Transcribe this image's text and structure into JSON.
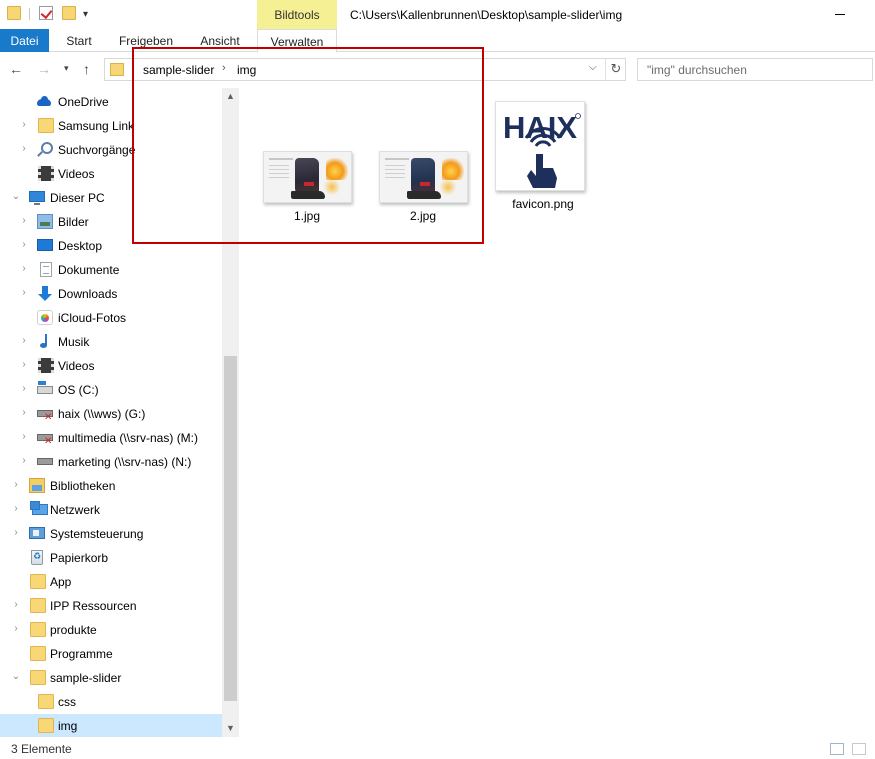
{
  "window": {
    "path_title": "C:\\Users\\Kallenbrunnen\\Desktop\\sample-slider\\img",
    "context_tab_group": "Bildtools"
  },
  "ribbon": {
    "tabs": [
      {
        "label": "Datei"
      },
      {
        "label": "Start"
      },
      {
        "label": "Freigeben"
      },
      {
        "label": "Ansicht"
      },
      {
        "label": "Verwalten"
      }
    ]
  },
  "address": {
    "crumbs": [
      "sample-slider",
      "img"
    ],
    "search_placeholder": "\"img\" durchsuchen"
  },
  "nav": {
    "items": [
      {
        "label": "OneDrive",
        "icon": "onedrive-icon",
        "expandable": false
      },
      {
        "label": "Samsung Link",
        "icon": "folder-icon",
        "expandable": true
      },
      {
        "label": "Suchvorgänge",
        "icon": "search-icon",
        "expandable": true
      },
      {
        "label": "Videos",
        "icon": "video-icon",
        "expandable": false
      },
      {
        "label": "Dieser PC",
        "icon": "pc-icon",
        "expandable": true,
        "expanded": true
      },
      {
        "label": "Bilder",
        "icon": "pictures-icon",
        "expandable": true
      },
      {
        "label": "Desktop",
        "icon": "desktop-icon",
        "expandable": true
      },
      {
        "label": "Dokumente",
        "icon": "documents-icon",
        "expandable": true
      },
      {
        "label": "Downloads",
        "icon": "downloads-icon",
        "expandable": true
      },
      {
        "label": "iCloud-Fotos",
        "icon": "icloud-photos-icon",
        "expandable": false
      },
      {
        "label": "Musik",
        "icon": "music-icon",
        "expandable": true
      },
      {
        "label": "Videos",
        "icon": "video-icon",
        "expandable": true
      },
      {
        "label": "OS (C:)",
        "icon": "drive-icon",
        "expandable": true
      },
      {
        "label": "haix (\\\\wws) (G:)",
        "icon": "network-drive-disconnected-icon",
        "expandable": true
      },
      {
        "label": "multimedia (\\\\srv-nas) (M:)",
        "icon": "network-drive-disconnected-icon",
        "expandable": true
      },
      {
        "label": "marketing (\\\\srv-nas) (N:)",
        "icon": "network-drive-icon",
        "expandable": true
      },
      {
        "label": "Bibliotheken",
        "icon": "libraries-icon",
        "expandable": true
      },
      {
        "label": "Netzwerk",
        "icon": "network-icon",
        "expandable": true
      },
      {
        "label": "Systemsteuerung",
        "icon": "control-panel-icon",
        "expandable": true
      },
      {
        "label": "Papierkorb",
        "icon": "recycle-bin-icon",
        "expandable": false
      },
      {
        "label": "App",
        "icon": "folder-icon",
        "expandable": false
      },
      {
        "label": "IPP Ressourcen",
        "icon": "folder-icon",
        "expandable": true
      },
      {
        "label": "produkte",
        "icon": "folder-icon",
        "expandable": true
      },
      {
        "label": "Programme",
        "icon": "folder-icon",
        "expandable": false
      },
      {
        "label": "sample-slider",
        "icon": "folder-icon",
        "expandable": true,
        "expanded": true
      },
      {
        "label": "css",
        "icon": "folder-icon",
        "expandable": false
      },
      {
        "label": "img",
        "icon": "folder-icon",
        "expandable": false,
        "selected": true
      }
    ]
  },
  "files": [
    {
      "name": "1.jpg",
      "icon": "jpg-thumbnail"
    },
    {
      "name": "2.jpg",
      "icon": "jpg-thumbnail"
    },
    {
      "name": "favicon.png",
      "icon": "haix-logo-thumbnail"
    }
  ],
  "status": {
    "count": "3 Elemente"
  },
  "colors": {
    "accent": "#1979ca",
    "context_tab": "#f6f095",
    "selection": "#cce8ff",
    "annotation": "#c00000"
  }
}
